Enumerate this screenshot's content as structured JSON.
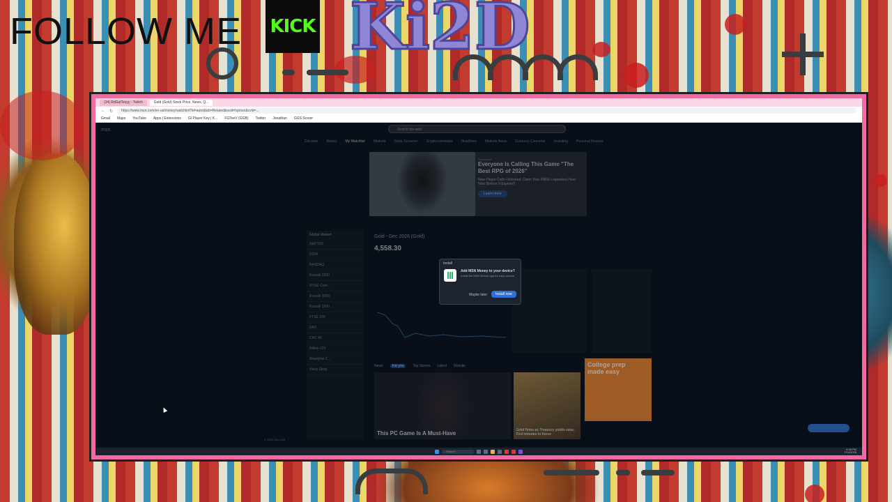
{
  "overlay": {
    "follow_text": "FOLLOW ME",
    "kick_label": "KICK",
    "brand_text": "Ki2D"
  },
  "browser": {
    "tabs": [
      {
        "label": "(34) RdGalTesyy - Twitch",
        "active": false
      },
      {
        "label": "Gold (Gold) Stock Price, News, Q...",
        "active": true
      }
    ],
    "url": "https://www.msn.com/en-us/money/watchlist?id=auto&tab=Related&ocid=hpmsn&cvid=...",
    "bookmarks": [
      "Gmail",
      "Maps",
      "YouTube",
      "Apps | Extensions",
      "GI Player Key | K...",
      "FGTeeV (GGB)",
      "Twitter",
      "Jonathan",
      "GGS Scorer"
    ]
  },
  "msn": {
    "logo": "msn",
    "search_placeholder": "Search the web",
    "nav": [
      "Discover",
      "Money",
      "My Watchlist",
      "Markets",
      "Stock Screener",
      "Cryptocurrencies",
      "Headlines",
      "Markets News",
      "Currency Converter",
      "Investing",
      "Personal Finance"
    ],
    "ad": {
      "sponsor": "Sponsored",
      "title": "Everyone Is Calling This Game \"The Best RPG of 2026\"",
      "body": "New Player Code Unlocked: Claim Your FREE Legendary Hero Now (Before It Expires!)",
      "button": "Learn more"
    },
    "global_market_title": "Global Market",
    "global_markets": [
      "S&P 500",
      "DOW",
      "NASDAQ",
      "Russell 2000",
      "NYSE Com...",
      "Russell 3000",
      "Russell 1000",
      "FTSE 100",
      "DAX",
      "CAC 40",
      "Nikkei 225",
      "Shanghai C...",
      "Hang Seng"
    ],
    "symbol_title": "Gold - Dec 2026 (Gold)",
    "price": "4,558.30",
    "news_tabs": [
      "News",
      "For you",
      "Top Stories",
      "Latest",
      "Results"
    ],
    "news_main_caption": "This PC Game Is A Must-Have",
    "news_side_caption": "Gold firms as Treasury yields ease, Fed minutes in focus",
    "college_ad": "College prep made easy",
    "footer_copyright": "© 2026 Microsoft"
  },
  "install_modal": {
    "header": "Install",
    "title": "Add MSN Money to your device?",
    "desc": "Install the MSN Money app for easy access.",
    "maybe_later": "Maybe later",
    "install_now": "Install now"
  },
  "taskbar": {
    "search": "Search",
    "time": "4:38 PM",
    "date": "7/14/2026"
  }
}
